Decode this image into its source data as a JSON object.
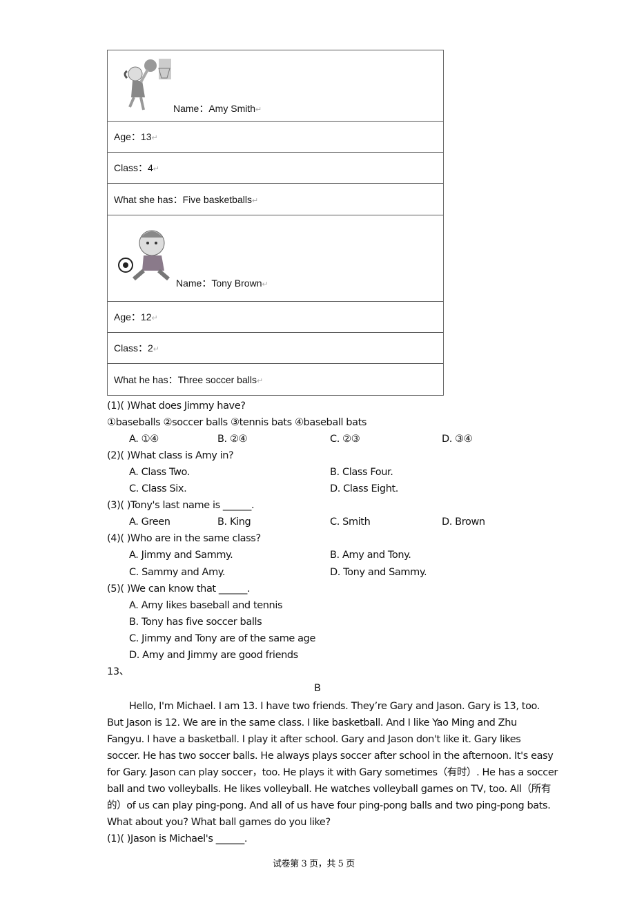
{
  "table": {
    "rows": [
      {
        "text": "Name：Amy Smith",
        "picture": "girl-basketball-picture"
      },
      {
        "text": "Age：13"
      },
      {
        "text": "Class：4"
      },
      {
        "text": "What she has：Five basketballs"
      },
      {
        "text": "Name：Tony Brown",
        "picture": "boy-soccer-picture"
      },
      {
        "text": "Age：12"
      },
      {
        "text": "Class：2"
      },
      {
        "text": "What he has：Three soccer balls"
      }
    ],
    "para_mark": "↵"
  },
  "questions": [
    {
      "stem": "(1)(        )What does Jimmy have?",
      "extra": "①baseballs ②soccer balls ③tennis bats ④baseball bats",
      "options": [
        "A. ①④",
        "B. ②④",
        "C. ②③",
        "D. ③④"
      ]
    },
    {
      "stem": "(2)(        )What class is Amy in?",
      "options": [
        "A. Class Two.",
        "B. Class Four.",
        "C. Class Six.",
        "D. Class Eight."
      ]
    },
    {
      "stem": "(3)(        )Tony's last name is ______.",
      "options": [
        "A. Green",
        "B. King",
        "C. Smith",
        "D. Brown"
      ]
    },
    {
      "stem": "(4)(        )Who are in the same class?",
      "options": [
        "A. Jimmy and Sammy.",
        "B. Amy and Tony.",
        "C. Sammy and Amy.",
        "D. Tony and Sammy."
      ]
    },
    {
      "stem": "(5)(        )We can know that ______.",
      "options": [
        "A. Amy likes baseball and tennis",
        "B. Tony has five soccer balls",
        "C. Jimmy and Tony are of the same age",
        "D. Amy and Jimmy are good friends"
      ]
    }
  ],
  "section13": {
    "number": "13、",
    "title": "B",
    "passage_lines": [
      "Hello, I'm Michael. I am 13. I have two friends. They’re Gary and Jason. Gary is 13, too.",
      "But Jason is 12. We are in the same class. I like basketball. And I like Yao Ming and Zhu",
      "Fangyu. I have a basketball. I play it after school. Gary and Jason don't like it. Gary likes",
      "soccer. He has two soccer balls. He always plays soccer after school in the afternoon. It's easy",
      "for Gary. Jason can play soccer，too. He plays it with Gary sometimes（有时）. He has a soccer",
      "ball and two volleyballs. He likes volleyball. He watches volleyball games on TV, too. All（所有",
      "的）of us can play ping-pong. And all of us have four ping-pong balls and two ping-pong bats.",
      "What about you? What ball games do you like?"
    ],
    "q1": "(1)(        )Jason is Michael's ______."
  },
  "footer": "试卷第 3 页，共 5 页"
}
